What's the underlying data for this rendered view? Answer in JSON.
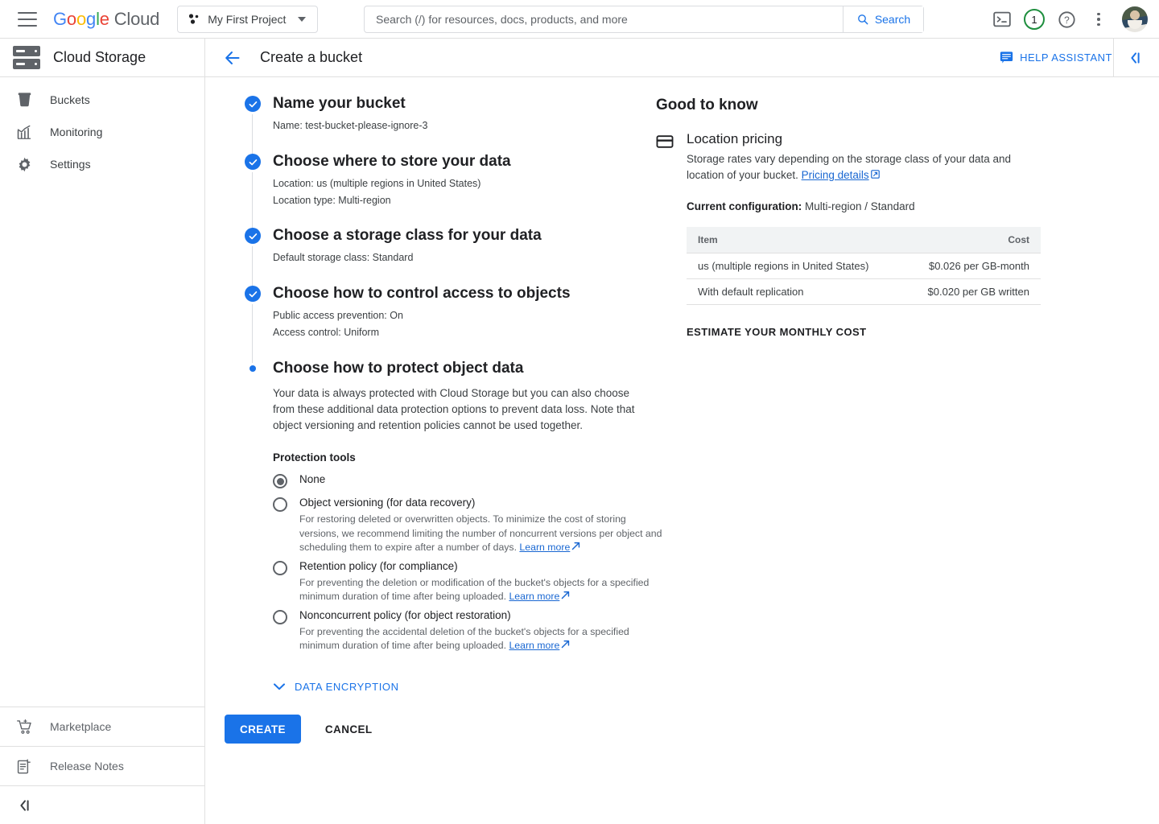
{
  "topbar": {
    "menu_icon": "hamburger-icon",
    "logo": {
      "google": "Google",
      "cloud": "Cloud"
    },
    "project": {
      "label": "My First Project",
      "icon": "project-dots-icon"
    },
    "search": {
      "placeholder": "Search (/) for resources, docs, products, and more",
      "value": "",
      "button_label": "Search",
      "icon": "search-icon"
    },
    "icons": {
      "terminal": "terminal-icon",
      "notifications_count": "1",
      "help": "help-icon",
      "more": "kebab-menu-icon",
      "avatar": "user-avatar"
    }
  },
  "sidebar": {
    "product_title": "Cloud Storage",
    "product_icon": "cloud-storage-icon",
    "items": [
      {
        "label": "Buckets",
        "icon": "bucket-icon"
      },
      {
        "label": "Monitoring",
        "icon": "chart-icon"
      },
      {
        "label": "Settings",
        "icon": "gear-icon"
      }
    ],
    "bottom_items": [
      {
        "label": "Marketplace",
        "icon": "shopping-cart-icon"
      },
      {
        "label": "Release Notes",
        "icon": "release-notes-icon"
      }
    ],
    "collapse_icon": "collapse-sidebar-icon"
  },
  "pageheader": {
    "back_icon": "back-arrow-icon",
    "title": "Create a bucket",
    "help_assistant": "HELP ASSISTANT",
    "help_assistant_icon": "chat-icon",
    "panel_collapse_icon": "collapse-panel-icon"
  },
  "steps": [
    {
      "status": "complete",
      "title": "Name your bucket",
      "details": [
        "Name: test-bucket-please-ignore-3"
      ]
    },
    {
      "status": "complete",
      "title": "Choose where to store your data",
      "details": [
        "Location: us (multiple regions in United States)",
        "Location type: Multi-region"
      ]
    },
    {
      "status": "complete",
      "title": "Choose a storage class for your data",
      "details": [
        "Default storage class: Standard"
      ]
    },
    {
      "status": "complete",
      "title": "Choose how to control access to objects",
      "details": [
        "Public access prevention: On",
        "Access control: Uniform"
      ]
    }
  ],
  "active_step": {
    "status": "active",
    "title": "Choose how to protect object data",
    "body": "Your data is always protected with Cloud Storage but you can also choose from these additional data protection options to prevent data loss. Note that object versioning and retention policies cannot be used together.",
    "tools_label": "Protection tools",
    "options": [
      {
        "label": "None",
        "selected": true,
        "description": "",
        "link": ""
      },
      {
        "label": "Object versioning (for data recovery)",
        "selected": false,
        "description": "For restoring deleted or overwritten objects. To minimize the cost of storing versions, we recommend limiting the number of noncurrent versions per object and scheduling them to expire after a number of days.",
        "link": "Learn more"
      },
      {
        "label": "Retention policy (for compliance)",
        "selected": false,
        "description": "For preventing the deletion or modification of the bucket's objects for a specified minimum duration of time after being uploaded.",
        "link": "Learn more"
      },
      {
        "label": "Nonconcurrent policy (for object restoration)",
        "selected": false,
        "description": "For preventing the accidental deletion of the bucket's objects for a specified minimum duration of time after being uploaded.",
        "link": "Learn more"
      }
    ]
  },
  "data_encryption": {
    "label": "DATA ENCRYPTION",
    "icon": "chevron-down-icon"
  },
  "actions": {
    "create": "CREATE",
    "cancel": "CANCEL"
  },
  "info_panel": {
    "heading": "Good to know",
    "card_icon": "credit-card-icon",
    "section_title": "Location pricing",
    "paragraph": "Storage rates vary depending on the storage class of your data and location of your bucket.",
    "paragraph_link": "Pricing details",
    "config_label": "Current configuration",
    "config_value": "Multi-region / Standard",
    "table": {
      "columns": [
        "Item",
        "Cost"
      ],
      "rows": [
        [
          "us (multiple regions in United States)",
          "$0.026 per GB-month"
        ],
        [
          "With default replication",
          "$0.020 per GB written"
        ]
      ]
    },
    "estimate_label": "ESTIMATE YOUR MONTHLY COST"
  },
  "colors": {
    "accent": "#1a73e8",
    "link": "#1967d2",
    "border": "#e0e0e0",
    "text": "#202124",
    "muted": "#5f6368",
    "badge_green": "#1e8e3e"
  }
}
